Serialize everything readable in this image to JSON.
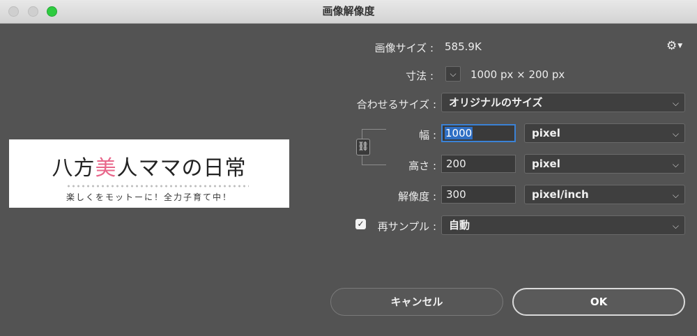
{
  "window": {
    "title": "画像解像度"
  },
  "preview": {
    "title_part1": "八方",
    "title_accent": "美",
    "title_part2": "人ママの日常",
    "subtitle": "楽しくをモットーに！全力子育て中！",
    "accent_color": "#e8668a"
  },
  "image_size": {
    "label": "画像サイズ :",
    "value": "585.9K"
  },
  "dimensions": {
    "label": "寸法 :",
    "value": "1000 px × 200 px"
  },
  "fit_to": {
    "label": "合わせるサイズ :",
    "value": "オリジナルのサイズ"
  },
  "width": {
    "label": "幅 :",
    "value": "1000",
    "unit": "pixel"
  },
  "height": {
    "label": "高さ :",
    "value": "200",
    "unit": "pixel"
  },
  "resolution": {
    "label": "解像度 :",
    "value": "300",
    "unit": "pixel/inch"
  },
  "resample": {
    "label": "再サンプル :",
    "checked": true,
    "value": "自動"
  },
  "buttons": {
    "cancel": "キャンセル",
    "ok": "OK"
  },
  "icons": {
    "gear": "gear-icon",
    "link": "chain-link-icon",
    "chevron": "chevron-down-icon"
  }
}
